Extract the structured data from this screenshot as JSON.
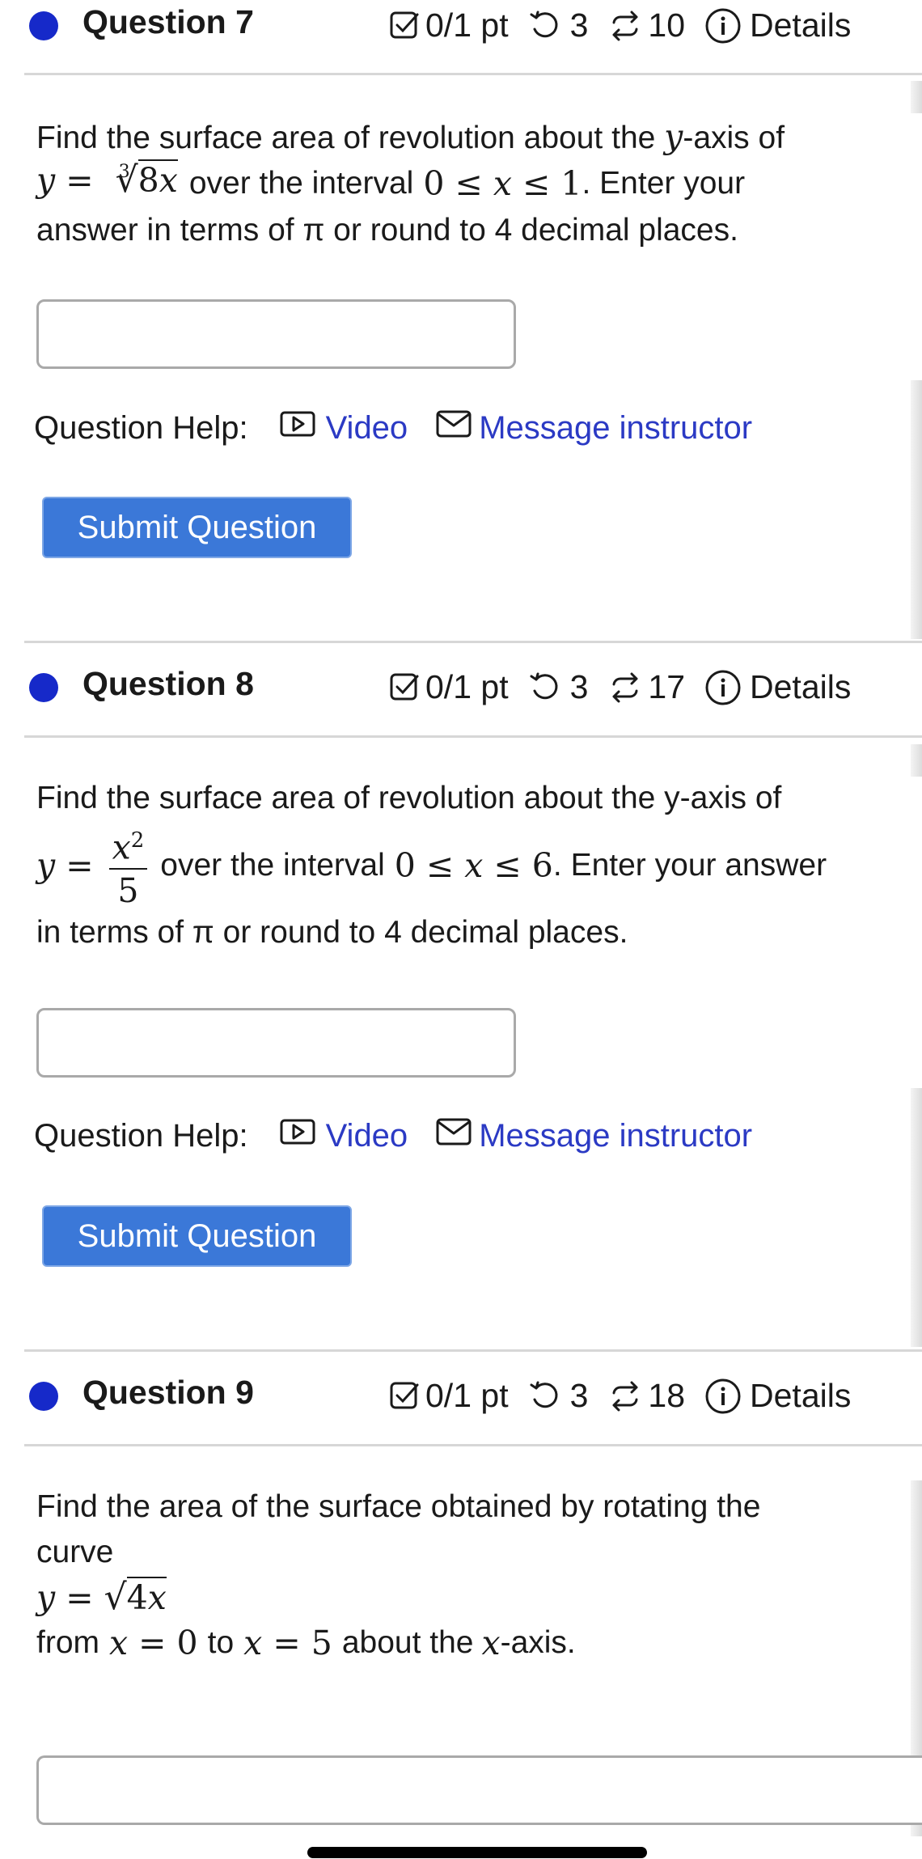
{
  "questions": [
    {
      "title": "Question 7",
      "score": "0/1 pt",
      "retries": "3",
      "attempts": "10",
      "details": "Details",
      "text_before": "Find the surface area of revolution about the ",
      "axis_var": "y",
      "text_after_axis": "-axis of",
      "equation": "y = ∛(8x)",
      "interval_text_prefix": "over the interval",
      "interval": "0 ≤ x ≤ 1",
      "text_end_line1": ". Enter your",
      "text_line3": "answer in terms of π or round to 4 decimal places.",
      "help_label": "Question Help:",
      "video_label": "Video",
      "message_label": "Message instructor",
      "submit_label": "Submit Question"
    },
    {
      "title": "Question 8",
      "score": "0/1 pt",
      "retries": "3",
      "attempts": "17",
      "details": "Details",
      "text_line1": "Find the surface area of revolution about the y-axis of",
      "equation": "y = x²/5",
      "interval_text_prefix": "over the interval",
      "interval": "0 ≤ x ≤ 6",
      "text_end_line2": ". Enter your answer",
      "text_line3": "in terms of π or round to 4 decimal places.",
      "help_label": "Question Help:",
      "video_label": "Video",
      "message_label": "Message instructor",
      "submit_label": "Submit Question"
    },
    {
      "title": "Question 9",
      "score": "0/1 pt",
      "retries": "3",
      "attempts": "18",
      "details": "Details",
      "text_line1": "Find the area of the surface obtained by rotating the",
      "text_line2": "curve",
      "equation": "y = √(4x)",
      "from_text": "from",
      "from_expr": "x = 0",
      "to_text": "to",
      "to_expr": "x = 5",
      "about_text": "about the",
      "axis_var": "x",
      "axis_suffix": "-axis."
    }
  ],
  "colors": {
    "dot": "#1629c9",
    "link": "#2b3ac4",
    "submit_bg": "#3b78d8",
    "divider": "#d7d7d7"
  },
  "icons": [
    "checkbox-icon",
    "retry-icon",
    "attempts-icon",
    "info-icon",
    "video-icon",
    "mail-icon"
  ]
}
